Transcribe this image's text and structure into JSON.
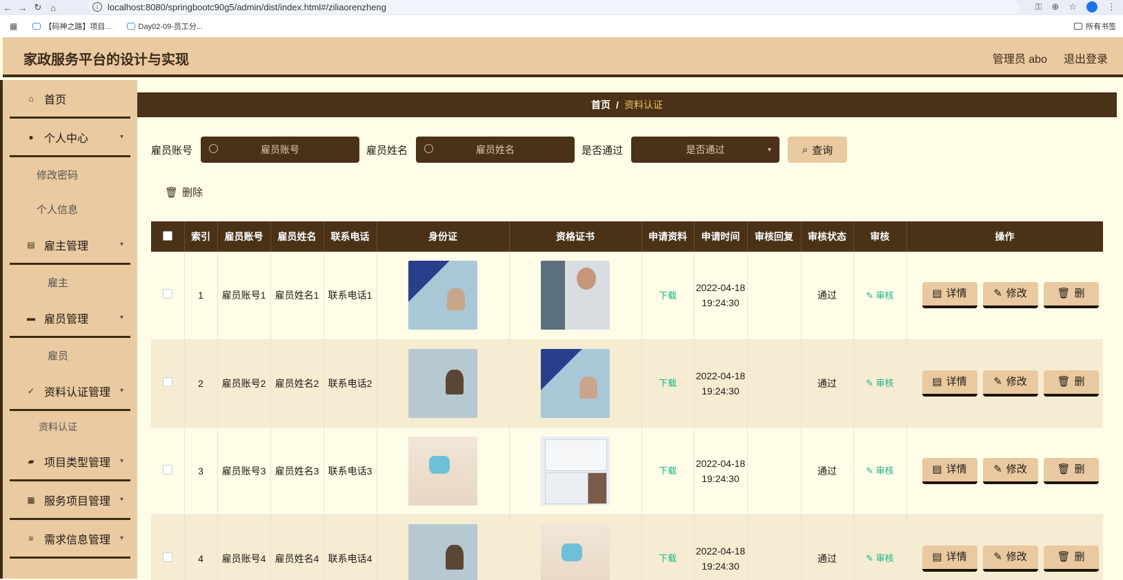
{
  "browser": {
    "url": "localhost:8080/springbootc90g5/admin/dist/index.html#/ziliaorenzheng",
    "bookmarks": [
      "【码神之路】项目...",
      "Day02-09-员工分..."
    ],
    "all_bookmarks": "所有书签"
  },
  "header": {
    "title": "家政服务平台的设计与实现",
    "admin_label": "管理员 abo",
    "logout_label": "退出登录"
  },
  "sidebar": {
    "home": "首页",
    "personal_center": "个人中心",
    "change_password": "修改密码",
    "personal_info": "个人信息",
    "employer_mgmt": "雇主管理",
    "employer": "雇主",
    "employee_mgmt": "雇员管理",
    "employee": "雇员",
    "cert_mgmt": "资料认证管理",
    "cert": "资料认证",
    "project_type_mgmt": "项目类型管理",
    "service_project_mgmt": "服务项目管理",
    "demand_mgmt": "需求信息管理"
  },
  "breadcrumb": {
    "home": "首页",
    "sep": "/",
    "current": "资料认证"
  },
  "filters": {
    "account_label": "雇员账号",
    "account_placeholder": "雇员账号",
    "name_label": "雇员姓名",
    "name_placeholder": "雇员姓名",
    "passed_label": "是否通过",
    "passed_placeholder": "是否通过",
    "query_label": "查询"
  },
  "delete_label": "删除",
  "table": {
    "headers": [
      "索引",
      "雇员账号",
      "雇员姓名",
      "联系电话",
      "身份证",
      "资格证书",
      "申请资料",
      "申请时间",
      "审核回复",
      "审核状态",
      "审核",
      "操作"
    ],
    "rows": [
      {
        "index": "1",
        "account": "雇员账号1",
        "name": "雇员姓名1",
        "phone": "联系电话1",
        "download": "下载",
        "time": "2022-04-18 19:24:30",
        "reply": "",
        "status": "通过",
        "review": "审核",
        "id_img": "idcard-blue",
        "cert_img": "machine"
      },
      {
        "index": "2",
        "account": "雇员账号2",
        "name": "雇员姓名2",
        "phone": "联系电话2",
        "download": "下载",
        "time": "2022-04-18 19:24:30",
        "reply": "",
        "status": "通过",
        "review": "审核",
        "id_img": "idcard-gray",
        "cert_img": "idcard-blue"
      },
      {
        "index": "3",
        "account": "雇员账号3",
        "name": "雇员姓名3",
        "phone": "联系电话3",
        "download": "下载",
        "time": "2022-04-18 19:24:30",
        "reply": "",
        "status": "通过",
        "review": "审核",
        "id_img": "person-mask",
        "cert_img": "permit"
      },
      {
        "index": "4",
        "account": "雇员账号4",
        "name": "雇员姓名4",
        "phone": "联系电话4",
        "download": "下载",
        "time": "2022-04-18 19:24:30",
        "reply": "",
        "status": "通过",
        "review": "审核",
        "id_img": "idcard-gray",
        "cert_img": "person-mask"
      }
    ],
    "ops": {
      "detail": "详情",
      "edit": "修改",
      "delete": "删"
    }
  },
  "colors": {
    "header_bg": "#eacaa0",
    "dark_brown": "#4a3118",
    "accent_gold": "#f0c860",
    "link_green": "#19b38a"
  }
}
